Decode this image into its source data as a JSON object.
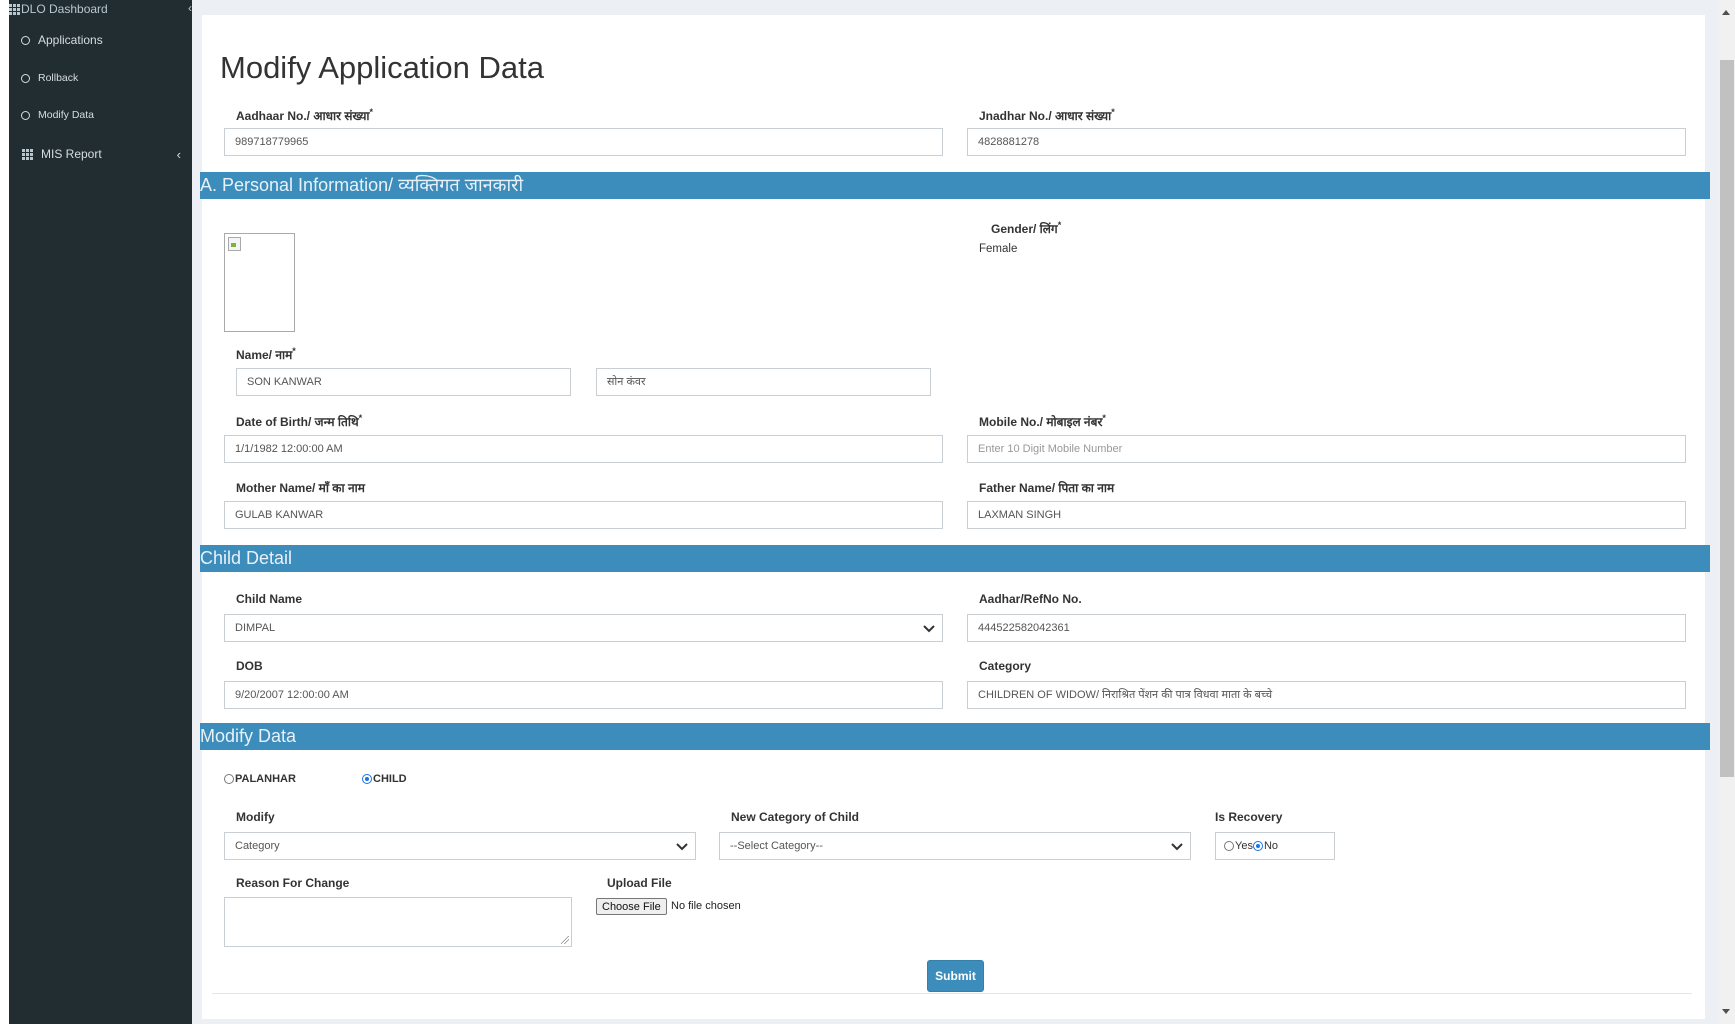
{
  "sidebar": {
    "header": "DLO Dashboard",
    "items": [
      {
        "label": "Applications"
      },
      {
        "label": "Rollback"
      },
      {
        "label": "Modify Data"
      },
      {
        "label": "MIS Report"
      }
    ]
  },
  "page": {
    "title": "Modify Application Data"
  },
  "ids": {
    "aadhaar_label": "Aadhaar No./ आधार संख्या",
    "aadhaar_value": "989718779965",
    "jnadhar_label": "Jnadhar No./ आधार संख्या",
    "jnadhar_value": "4828881278"
  },
  "personal": {
    "section_title": "A. Personal Information/ व्यक्तिगत जानकारी",
    "gender_label": "Gender/ लिंग",
    "gender_value": "Female",
    "name_label": "Name/ नाम",
    "name_en": "SON KANWAR",
    "name_hi": "सोन कंवर",
    "dob_label": "Date of Birth/ जन्म तिथि",
    "dob_value": "1/1/1982 12:00:00 AM",
    "mobile_label": "Mobile No./ मोबाइल नंबर",
    "mobile_placeholder": "Enter 10 Digit Mobile Number",
    "mother_label": "Mother Name/ माँ का नाम",
    "mother_value": "GULAB KANWAR",
    "father_label": "Father Name/ पिता का नाम",
    "father_value": "LAXMAN SINGH"
  },
  "child": {
    "section_title": "Child Detail",
    "name_label": "Child Name",
    "name_value": "DIMPAL",
    "aadhar_label": "Aadhar/RefNo No.",
    "aadhar_value": "444522582042361",
    "dob_label": "DOB",
    "dob_value": "9/20/2007 12:00:00 AM",
    "category_label": "Category",
    "category_value": "CHILDREN OF WIDOW/ निराश्रित पेंशन की पात्र विधवा माता के बच्चे"
  },
  "modify": {
    "section_title": "Modify Data",
    "radio_palanhar": "PALANHAR",
    "radio_child": "CHILD",
    "modify_label": "Modify",
    "modify_value": "Category",
    "new_category_label": "New Category of Child",
    "new_category_value": "--Select Category--",
    "recovery_label": "Is Recovery",
    "recovery_yes": "Yes",
    "recovery_no": "No",
    "reason_label": "Reason For Change",
    "upload_label": "Upload File",
    "choose_file": "Choose File",
    "no_file": "No file chosen",
    "submit": "Submit"
  }
}
